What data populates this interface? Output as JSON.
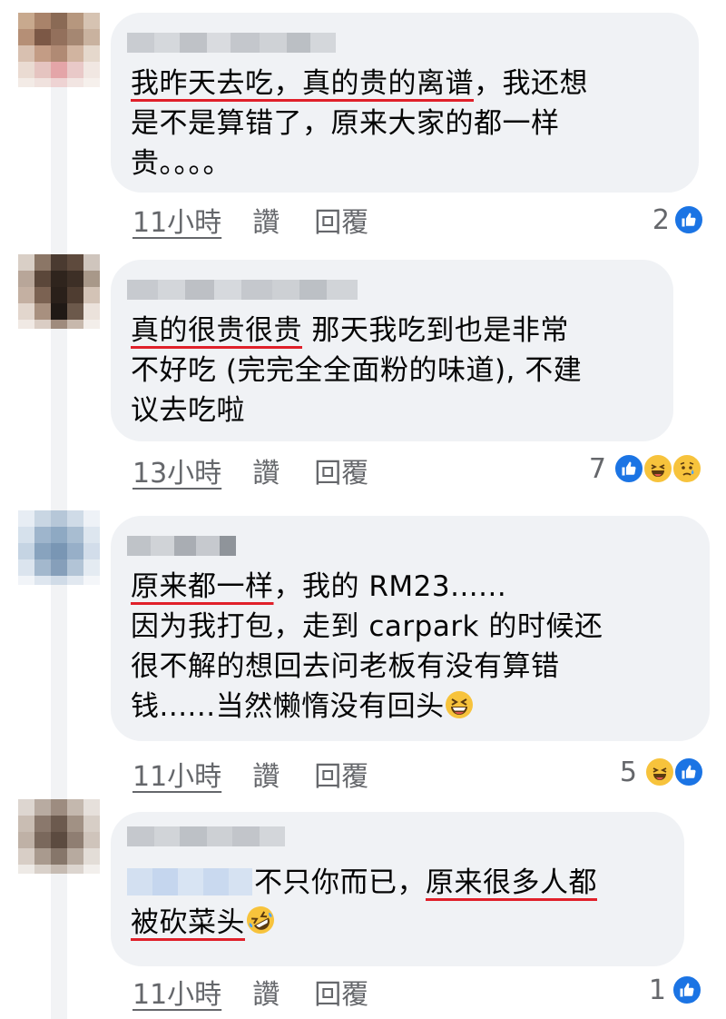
{
  "colors": {
    "bubble": "#f0f2f5",
    "underline": "#e0202a",
    "meta_text": "#65676b",
    "like_blue": "#1b74e4",
    "haha_yellow": "#f7c33c"
  },
  "comments": [
    {
      "lines": [
        {
          "parts": [
            {
              "t": "我昨天去吃，真的贵的离谱",
              "u": true
            },
            {
              "t": "，我还想"
            }
          ]
        },
        {
          "parts": [
            {
              "t": "是不是算错了，原来大家的都一样"
            }
          ]
        },
        {
          "parts": [
            {
              "t": "贵。。。。"
            }
          ]
        }
      ],
      "time": "11小時",
      "like_label": "讚",
      "reply_label": "回覆",
      "reaction_count": "2",
      "reactions": [
        "like-icon"
      ]
    },
    {
      "lines": [
        {
          "parts": [
            {
              "t": "真的很贵很贵",
              "u": true
            },
            {
              "t": " 那天我吃到也是非常"
            }
          ]
        },
        {
          "parts": [
            {
              "t": "不好吃 (完完全全面粉的味道), 不建"
            }
          ]
        },
        {
          "parts": [
            {
              "t": "议去吃啦"
            }
          ]
        }
      ],
      "time": "13小時",
      "like_label": "讚",
      "reply_label": "回覆",
      "reaction_count": "7",
      "reactions": [
        "like-icon",
        "haha-icon",
        "sad-icon"
      ]
    },
    {
      "lines": [
        {
          "parts": [
            {
              "t": "原来都一样",
              "u": true
            },
            {
              "t": "，我的 RM23......"
            }
          ]
        },
        {
          "parts": [
            {
              "t": "因为我打包，走到 carpark 的时候还"
            }
          ]
        },
        {
          "parts": [
            {
              "t": "很不解的想回去问老板有没有算错"
            }
          ]
        },
        {
          "parts": [
            {
              "t": "钱......当然懒惰没有回头"
            },
            {
              "emoji": "grin-squint-emoji"
            }
          ]
        }
      ],
      "time": "11小時",
      "like_label": "讚",
      "reply_label": "回覆",
      "reaction_count": "5",
      "reactions": [
        "haha-icon",
        "like-icon"
      ]
    },
    {
      "lines": [
        {
          "parts": [
            {
              "t": "不只你而已，"
            },
            {
              "t": "原来很多人都",
              "u": true
            }
          ]
        },
        {
          "parts": [
            {
              "t": "被砍菜头",
              "u": true
            },
            {
              "emoji": "rofl-emoji"
            }
          ]
        }
      ],
      "time": "11小時",
      "like_label": "讚",
      "reply_label": "回覆",
      "reaction_count": "1",
      "reactions": [
        "like-icon"
      ]
    }
  ]
}
